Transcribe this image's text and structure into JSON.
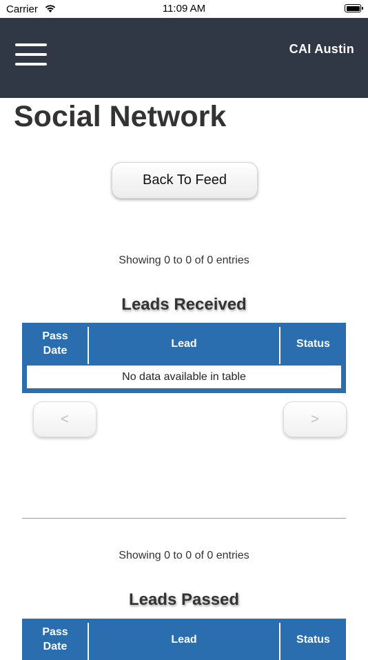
{
  "status_bar": {
    "carrier": "Carrier",
    "time": "11:09 AM"
  },
  "header": {
    "title": "CAI Austin",
    "background": "#313845"
  },
  "page": {
    "title": "Social Network",
    "back_button": "Back To Feed"
  },
  "received": {
    "showing": "Showing 0 to 0 of 0 entries",
    "title": "Leads Received",
    "columns": {
      "pass_date": "Pass Date",
      "lead": "Lead",
      "status": "Status"
    },
    "empty": "No data available in table",
    "prev": "<",
    "next": ">"
  },
  "passed": {
    "showing": "Showing 0 to 0 of 0 entries",
    "title": "Leads Passed",
    "columns": {
      "pass_date": "Pass Date",
      "lead": "Lead",
      "status": "Status"
    }
  },
  "colors": {
    "table_header": "#2a6eb0",
    "header_bar": "#313845"
  }
}
